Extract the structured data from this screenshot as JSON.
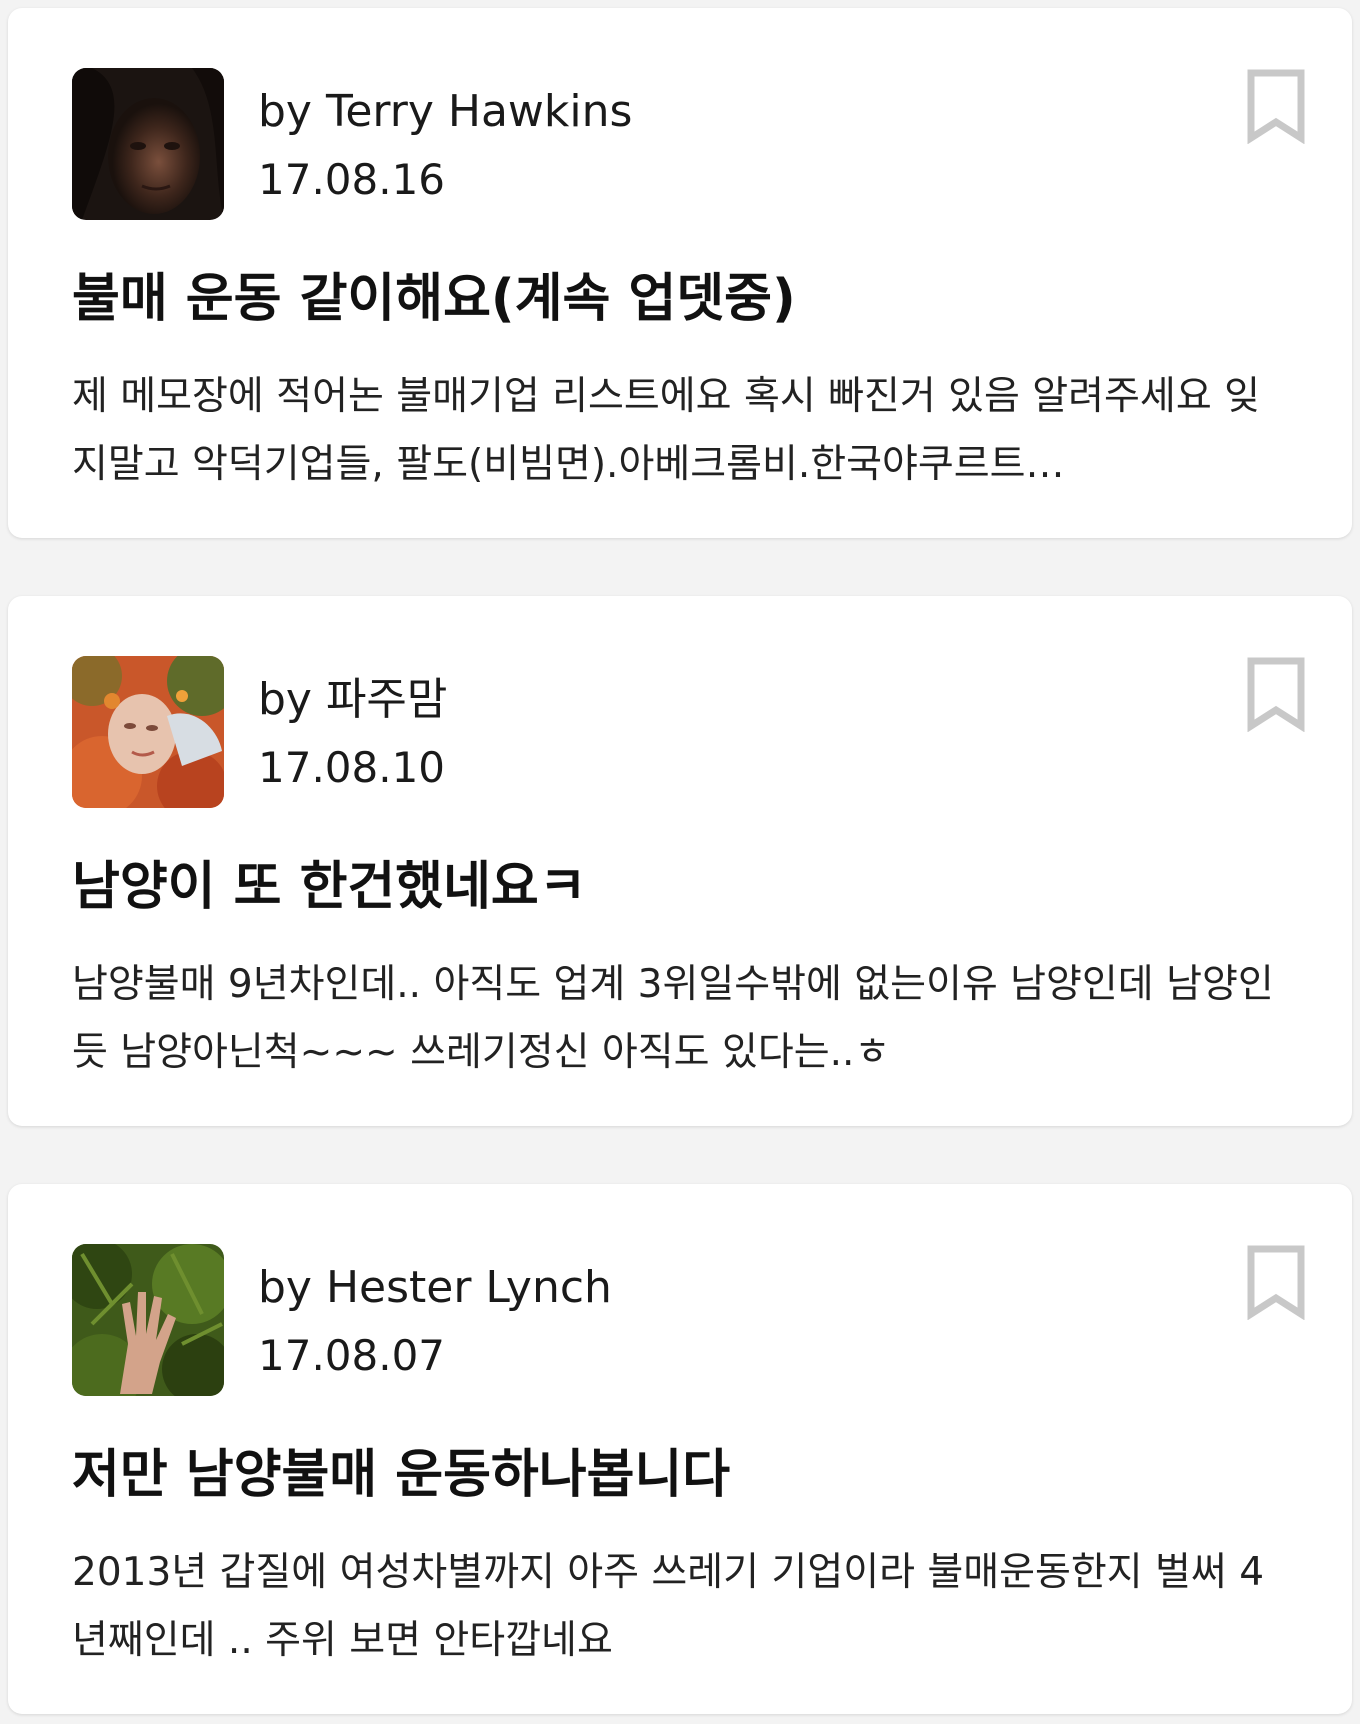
{
  "posts": [
    {
      "author": "by Terry Hawkins",
      "date": "17.08.16",
      "title": "불매 운동 같이해요(계속 업뎃중)",
      "excerpt": "제 메모장에 적어논 불매기업 리스트에요 혹시 빠진거 있음 알려주세요 잊지말고 악덕기업들, 팔도(비빔면).아베크롬비.한국야쿠르트…",
      "avatar_icon": "portrait-photo",
      "bookmark_icon": "bookmark-icon"
    },
    {
      "author": "by 파주맘",
      "date": "17.08.10",
      "title": "남양이 또 한건했네요ㅋ",
      "excerpt": "남양불매 9년차인데.. 아직도 업계 3위일수밖에 없는이유 남양인데 남양인듯 남양아닌척~~~ 쓰레기정신 아직도 있다는..ㅎ",
      "avatar_icon": "autumn-leaves-photo",
      "bookmark_icon": "bookmark-icon"
    },
    {
      "author": "by Hester Lynch",
      "date": "17.08.07",
      "title": "저만 남양불매 운동하나봅니다",
      "excerpt": "2013년 갑질에 여성차별까지 아주 쓰레기 기업이라 불매운동한지 벌써 4년째인데 .. 주위 보면 안타깝네요",
      "avatar_icon": "hand-in-fern-photo",
      "bookmark_icon": "bookmark-icon"
    }
  ],
  "colors": {
    "background": "#f3f3f3",
    "card": "#ffffff",
    "text": "#111111",
    "bookmark": "#c8c8c8"
  }
}
